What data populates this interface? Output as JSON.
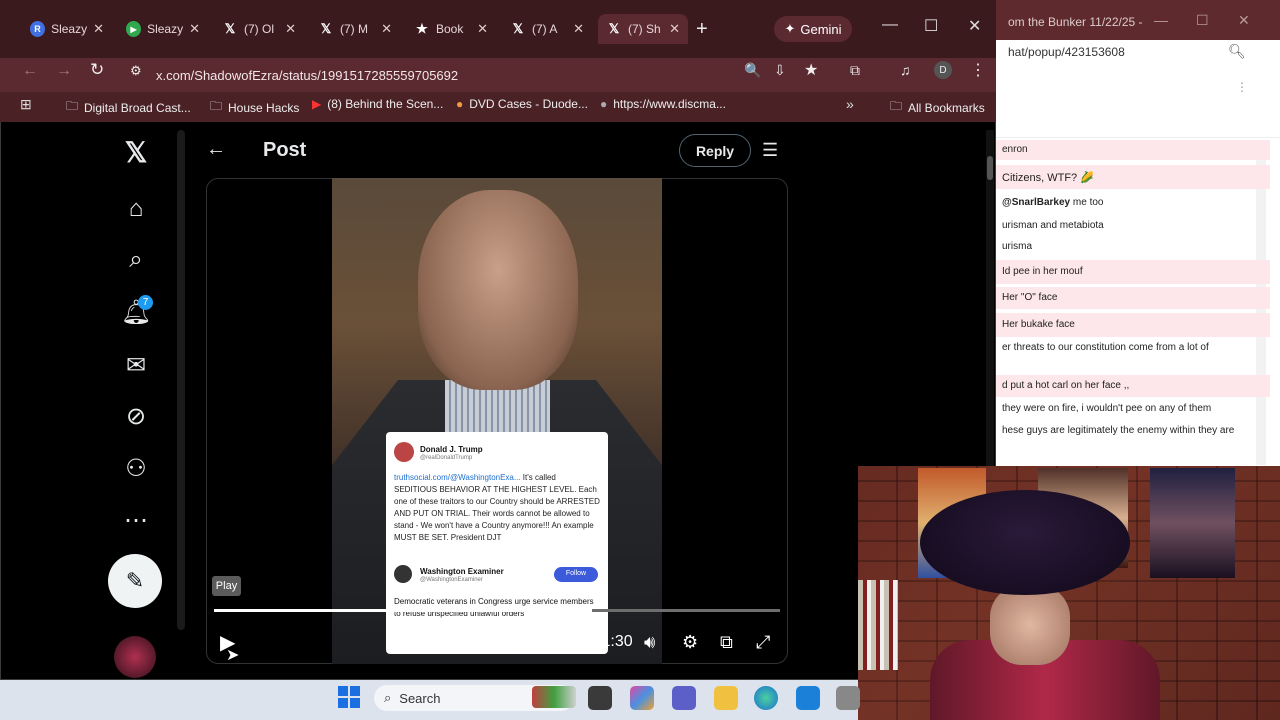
{
  "browser": {
    "tabs": [
      {
        "icon": "R",
        "label": "Sleazy"
      },
      {
        "icon": "▶",
        "label": "Sleazy"
      },
      {
        "icon": "𝕏",
        "label": "(7) Ol"
      },
      {
        "icon": "𝕏",
        "label": "(7) M"
      },
      {
        "icon": "★",
        "label": "Book"
      },
      {
        "icon": "𝕏",
        "label": "(7) A"
      },
      {
        "icon": "𝕏",
        "label": "(7) Sh"
      }
    ],
    "gemini_label": "Gemini",
    "url": "x.com/ShadowofEzra/status/1991517285559705692",
    "bookmarks": [
      "Digital Broad Cast...",
      "House Hacks",
      "(8) Behind the Scen...",
      "DVD Cases - Duode...",
      "https://www.discma..."
    ],
    "all_bookmarks": "All Bookmarks"
  },
  "x": {
    "notification_count": "7",
    "page_title": "Post",
    "reply_label": "Reply",
    "tweet_card": {
      "author": "Donald J. Trump",
      "handle": "@realDonaldTrump",
      "link": "truthsocial.com/@WashingtonExa...",
      "body": "It's called SEDITIOUS BEHAVIOR AT THE HIGHEST LEVEL. Each one of these traitors to our Country should be ARRESTED AND PUT ON TRIAL. Their words cannot be allowed to stand - We won't have a Country anymore!!! An example MUST BE SET. President DJT",
      "quoted_author": "Washington Examiner",
      "quoted_handle": "@WashingtonExaminer",
      "follow_label": "Follow",
      "quoted_body": "Democratic veterans in Congress urge service members to refuse unspecified unlawful orders"
    },
    "player": {
      "tooltip": "Play",
      "time": "1:00 / 1:30",
      "progress": 0.667
    }
  },
  "chat": {
    "title": "om the Bunker 11/22/25 -",
    "url": "hat/popup/423153608",
    "messages": [
      {
        "text": "enron",
        "highlight": true
      },
      {
        "text": "Citizens, WTF? 🌽",
        "highlight": true
      },
      {
        "text": "@SnarlBarkey me too",
        "highlight": false
      },
      {
        "text": "urisman and metabiota",
        "highlight": false
      },
      {
        "text": "urisma",
        "highlight": false
      },
      {
        "text": "Id pee in her mouf",
        "highlight": true
      },
      {
        "text": "Her \"O\" face",
        "highlight": true
      },
      {
        "text": "Her bukake face",
        "highlight": true
      },
      {
        "text": "er threats to our constitution come from a lot of",
        "highlight": false
      },
      {
        "text": "d put a hot carl on her face ,,",
        "highlight": true
      },
      {
        "text": "they were on fire, i wouldn't pee on any of them",
        "highlight": false
      },
      {
        "text": "hese guys are legitimately the enemy within they are",
        "highlight": false
      }
    ]
  },
  "taskbar": {
    "search_placeholder": "Search"
  },
  "colors": {
    "x_blue": "#1d9bf0",
    "tab_bg": "#3b1a1e",
    "chat_highlight": "#fde7ea"
  }
}
